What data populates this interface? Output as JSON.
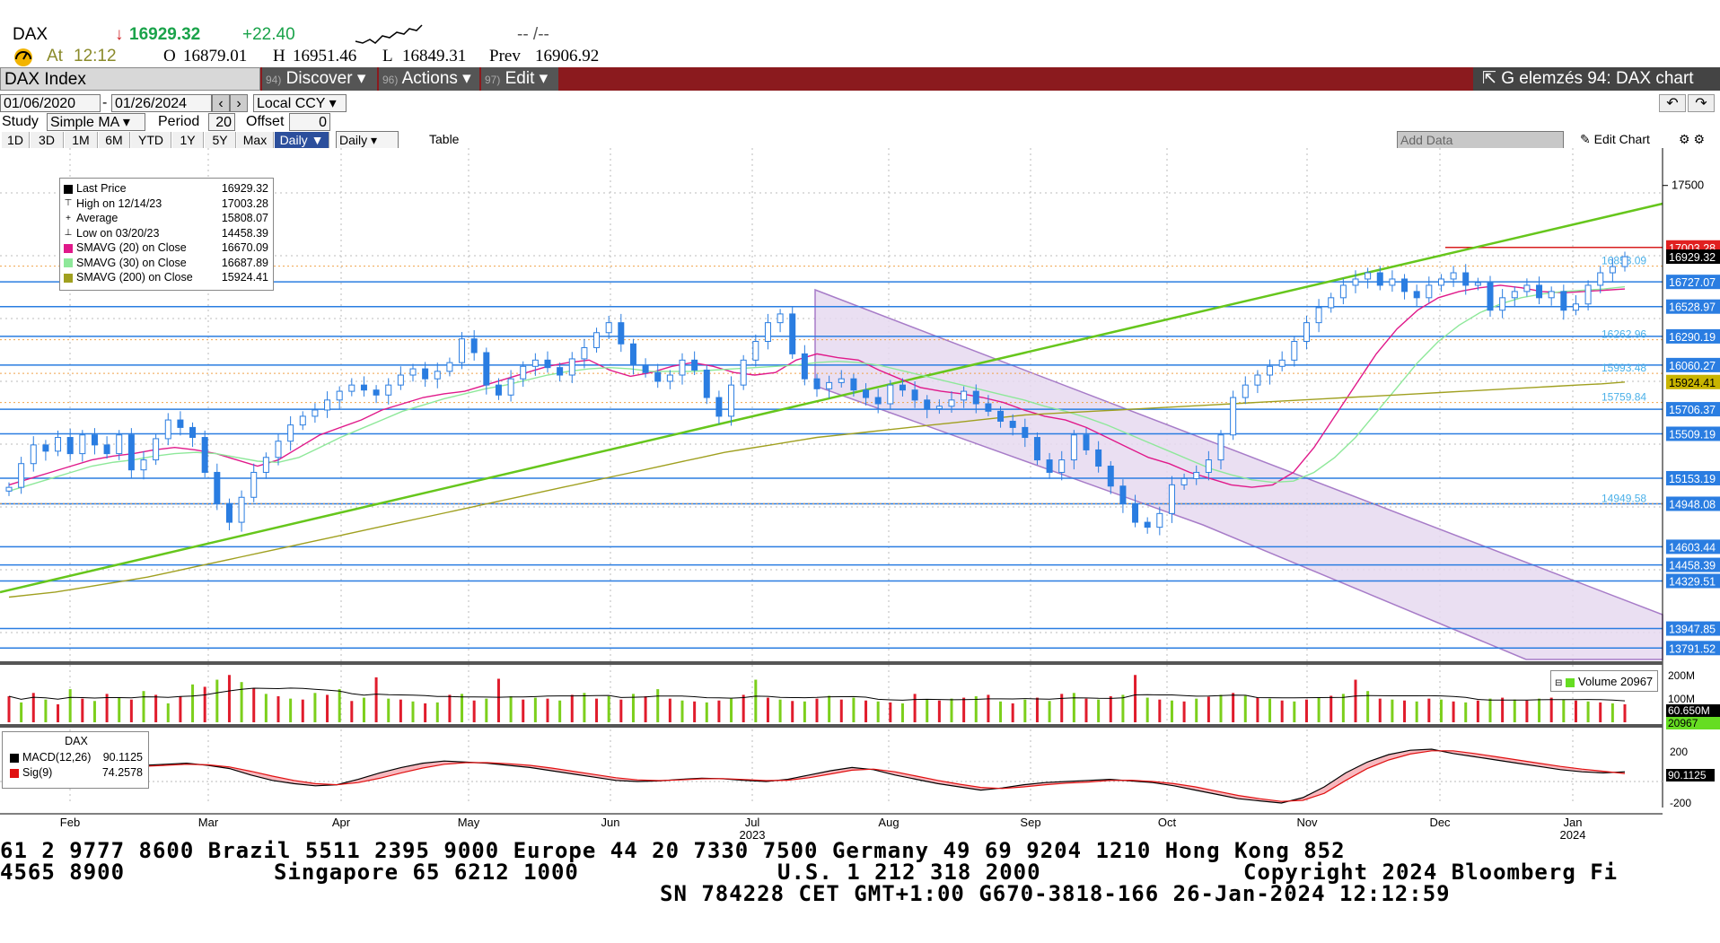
{
  "quote": {
    "ticker": "DAX",
    "arrow": "↓",
    "last": "16929.32",
    "change": "+22.40",
    "dashes": "-- /--",
    "at_label": "At",
    "time": "12:12",
    "open_label": "O",
    "open": "16879.01",
    "high_label": "H",
    "high": "16951.46",
    "low_label": "L",
    "low": "16849.31",
    "prev_label": "Prev",
    "prev": "16906.92"
  },
  "toolbar": {
    "security": "DAX Index",
    "discover_num": "94)",
    "discover": "Discover",
    "actions_num": "96)",
    "actions": "Actions",
    "edit_num": "97)",
    "edit": "Edit",
    "title": "G elemzés 94: DAX chart"
  },
  "controls": {
    "start_date": "01/06/2020",
    "end_date": "01/26/2024",
    "currency": "Local CCY",
    "study_label": "Study",
    "study_value": "Simple MA",
    "period_label": "Period",
    "period_value": "20",
    "offset_label": "Offset",
    "offset_value": "0",
    "periods": [
      "1D",
      "3D",
      "1M",
      "6M",
      "YTD",
      "1Y",
      "5Y",
      "Max"
    ],
    "frequency": "Daily",
    "table_label": "Table",
    "add_data": "Add Data",
    "edit_chart": "Edit Chart"
  },
  "legend": [
    {
      "label": "Last Price",
      "value": "16929.32",
      "swatch": "#000000",
      "mark": "■"
    },
    {
      "label": "High on 12/14/23",
      "value": "17003.28",
      "swatch": "",
      "mark": "⊤"
    },
    {
      "label": "Average",
      "value": "15808.07",
      "swatch": "",
      "mark": "+"
    },
    {
      "label": "Low on 03/20/23",
      "value": "14458.39",
      "swatch": "",
      "mark": "⊥"
    },
    {
      "label": "SMAVG (20)  on Close",
      "value": "16670.09",
      "swatch": "#e0198a",
      "mark": ""
    },
    {
      "label": "SMAVG (30)  on Close",
      "value": "16687.89",
      "swatch": "#8ee89a",
      "mark": ""
    },
    {
      "label": "SMAVG (200)  on Close",
      "value": "15924.41",
      "swatch": "#a0a020",
      "mark": ""
    }
  ],
  "volume_legend": {
    "label": "Volume",
    "value": "20967"
  },
  "macd_legend": {
    "title": "DAX",
    "rows": [
      {
        "label": "MACD(12,26)",
        "value": "90.1125",
        "swatch": "#000000"
      },
      {
        "label": "Sig(9)",
        "value": "74.2578",
        "swatch": "#e01010"
      }
    ]
  },
  "chart_data": {
    "type": "candlestick",
    "x_labels": [
      "Feb",
      "Mar",
      "Apr",
      "May",
      "Jun",
      "Jul",
      "Aug",
      "Sep",
      "Oct",
      "Nov",
      "Dec",
      "Jan"
    ],
    "year_labels": {
      "Jul": "2023",
      "Jan": "2024"
    },
    "price_axis": {
      "ticks": [
        "17500"
      ],
      "ylim": [
        13700,
        17800
      ]
    },
    "price_tags": [
      {
        "value": 17003.28,
        "label": "17003.28",
        "color": "#e02020"
      },
      {
        "value": 16929.32,
        "label": "16929.32",
        "color": "#000000"
      },
      {
        "value": 16727.07,
        "label": "16727.07",
        "color": "#2a7de1"
      },
      {
        "value": 16528.97,
        "label": "16528.97",
        "color": "#2a7de1"
      },
      {
        "value": 16290.19,
        "label": "16290.19",
        "color": "#2a7de1"
      },
      {
        "value": 16060.27,
        "label": "16060.27",
        "color": "#2a7de1"
      },
      {
        "value": 15924.41,
        "label": "15924.41",
        "color": "#c8b400"
      },
      {
        "value": 15706.37,
        "label": "15706.37",
        "color": "#2a7de1"
      },
      {
        "value": 15509.19,
        "label": "15509.19",
        "color": "#2a7de1"
      },
      {
        "value": 15153.19,
        "label": "15153.19",
        "color": "#2a7de1"
      },
      {
        "value": 14948.08,
        "label": "14948.08",
        "color": "#2a7de1"
      },
      {
        "value": 14603.44,
        "label": "14603.44",
        "color": "#2a7de1"
      },
      {
        "value": 14458.39,
        "label": "14458.39",
        "color": "#2a7de1"
      },
      {
        "value": 14329.51,
        "label": "14329.51",
        "color": "#2a7de1"
      },
      {
        "value": 13947.85,
        "label": "13947.85",
        "color": "#2a7de1"
      },
      {
        "value": 13791.52,
        "label": "13791.52",
        "color": "#2a7de1"
      }
    ],
    "fib_labels": [
      {
        "value": 16853.09,
        "label": "16853.09"
      },
      {
        "value": 16262.96,
        "label": "16262.96"
      },
      {
        "value": 15993.48,
        "label": "15993.48"
      },
      {
        "value": 15759.84,
        "label": "15759.84"
      },
      {
        "value": 14949.58,
        "label": "14949.58"
      }
    ],
    "series": [
      {
        "name": "Last Price",
        "values": [
          15080,
          15270,
          15420,
          15370,
          15480,
          15350,
          15500,
          15420,
          15350,
          15500,
          15220,
          15300,
          15470,
          15620,
          15560,
          15480,
          15200,
          14950,
          14800,
          15000,
          15200,
          15320,
          15450,
          15580,
          15650,
          15700,
          15780,
          15850,
          15900,
          15860,
          15820,
          15900,
          15980,
          16030,
          15950,
          16010,
          16080,
          16270,
          16160,
          15900,
          15820,
          15950,
          16050,
          16100,
          16040,
          15980,
          16110,
          16200,
          16320,
          16400,
          16230,
          16060,
          16000,
          15930,
          15980,
          16100,
          16020,
          15800,
          15650,
          15900,
          16100,
          16250,
          16400,
          16470,
          16150,
          15950,
          15870,
          15920,
          15950,
          15860,
          15800,
          15750,
          15900,
          15860,
          15780,
          15710,
          15730,
          15780,
          15850,
          15750,
          15690,
          15610,
          15560,
          15480,
          15300,
          15200,
          15300,
          15500,
          15380,
          15250,
          15090,
          14950,
          14800,
          14760,
          14870,
          15100,
          15150,
          15200,
          15300,
          15500,
          15800,
          15900,
          15980,
          16050,
          16100,
          16250,
          16400,
          16520,
          16600,
          16700,
          16750,
          16800,
          16700,
          16750,
          16650,
          16600,
          16700,
          16750,
          16800,
          16700,
          16720,
          16500,
          16600,
          16650,
          16700,
          16600,
          16650,
          16500,
          16550,
          16700,
          16800,
          16850,
          16929
        ]
      },
      {
        "name": "SMAVG (20)",
        "values": [
          15100,
          15150,
          15200,
          15250,
          15300,
          15330,
          15350,
          15380,
          15400,
          15380,
          15350,
          15300,
          15250,
          15300,
          15400,
          15500,
          15560,
          15620,
          15700,
          15750,
          15800,
          15830,
          15850,
          15900,
          15950,
          16000,
          16050,
          16080,
          16100,
          16020,
          15970,
          16000,
          16050,
          16080,
          16050,
          16000,
          15980,
          16000,
          16100,
          16150,
          16120,
          16100,
          16020,
          15950,
          15880,
          15850,
          15830,
          15800,
          15760,
          15700,
          15650,
          15620,
          15560,
          15480,
          15400,
          15320,
          15270,
          15200,
          15150,
          15100,
          15080,
          15100,
          15200,
          15400,
          15650,
          15900,
          16150,
          16350,
          16500,
          16600,
          16650,
          16680,
          16700,
          16680,
          16650,
          16640,
          16650,
          16660,
          16670
        ]
      },
      {
        "name": "SMAVG (30)",
        "values": [
          15050,
          15100,
          15150,
          15200,
          15250,
          15280,
          15300,
          15330,
          15350,
          15360,
          15350,
          15320,
          15290,
          15280,
          15320,
          15400,
          15480,
          15550,
          15620,
          15690,
          15740,
          15790,
          15830,
          15870,
          15900,
          15940,
          15980,
          16010,
          16030,
          16040,
          16030,
          16010,
          16010,
          16010,
          16020,
          16030,
          16040,
          16050,
          16060,
          16080,
          16090,
          16080,
          16060,
          16020,
          15980,
          15940,
          15900,
          15860,
          15820,
          15780,
          15730,
          15690,
          15640,
          15580,
          15510,
          15440,
          15370,
          15300,
          15230,
          15180,
          15140,
          15120,
          15130,
          15200,
          15320,
          15480,
          15680,
          15880,
          16080,
          16250,
          16380,
          16480,
          16550,
          16600,
          16630,
          16650,
          16660,
          16670,
          16688
        ]
      },
      {
        "name": "SMAVG (200)",
        "values": [
          14200,
          14220,
          14240,
          14270,
          14300,
          14330,
          14360,
          14400,
          14440,
          14480,
          14520,
          14560,
          14600,
          14640,
          14680,
          14720,
          14760,
          14800,
          14840,
          14880,
          14920,
          14960,
          15000,
          15040,
          15080,
          15120,
          15160,
          15200,
          15240,
          15280,
          15320,
          15360,
          15390,
          15420,
          15450,
          15480,
          15500,
          15520,
          15540,
          15560,
          15580,
          15600,
          15620,
          15640,
          15660,
          15670,
          15680,
          15690,
          15700,
          15710,
          15720,
          15730,
          15740,
          15750,
          15760,
          15770,
          15780,
          15790,
          15800,
          15810,
          15820,
          15830,
          15840,
          15850,
          15860,
          15870,
          15880,
          15890,
          15900,
          15910,
          15924
        ]
      }
    ],
    "volume_axis": {
      "ticks": [
        "200M",
        "100M"
      ],
      "tags": [
        {
          "label": "60.650M",
          "color": "#000000"
        },
        {
          "label": "20967",
          "color": "#66dd22"
        }
      ]
    },
    "volume": [
      55,
      42,
      62,
      48,
      38,
      70,
      50,
      45,
      60,
      52,
      48,
      66,
      58,
      40,
      55,
      80,
      75,
      90,
      100,
      85,
      72,
      60,
      55,
      50,
      48,
      62,
      58,
      70,
      45,
      52,
      95,
      50,
      48,
      44,
      40,
      42,
      58,
      60,
      46,
      50,
      92,
      55,
      48,
      52,
      50,
      46,
      58,
      62,
      50,
      55,
      48,
      60,
      55,
      70,
      50,
      46,
      44,
      42,
      46,
      50,
      58,
      90,
      52,
      48,
      45,
      44,
      50,
      56,
      48,
      52,
      46,
      44,
      42,
      40,
      60,
      48,
      46,
      50,
      52,
      55,
      58,
      44,
      40,
      48,
      52,
      45,
      60,
      62,
      50,
      48,
      55,
      58,
      100,
      52,
      48,
      46,
      44,
      50,
      54,
      58,
      62,
      56,
      52,
      50,
      46,
      44,
      48,
      52,
      56,
      60,
      90,
      66,
      50,
      48,
      46,
      44,
      50,
      48,
      44,
      42,
      46,
      50,
      52,
      48,
      46,
      50,
      52,
      48,
      46,
      44,
      42,
      40,
      38
    ],
    "macd_axis": {
      "ticks": [
        "200",
        "0",
        "-200"
      ],
      "tag": "90.1125"
    },
    "macd": [
      150,
      160,
      170,
      150,
      120,
      60,
      10,
      -20,
      -40,
      -30,
      20,
      80,
      130,
      170,
      190,
      180,
      170,
      150,
      130,
      100,
      70,
      40,
      10,
      0,
      5,
      20,
      30,
      25,
      10,
      0,
      20,
      60,
      100,
      130,
      110,
      60,
      20,
      -20,
      -50,
      -80,
      -60,
      -30,
      -10,
      0,
      10,
      20,
      5,
      -10,
      -40,
      -80,
      -120,
      -160,
      -180,
      -200,
      -150,
      -50,
      80,
      180,
      250,
      290,
      300,
      260,
      230,
      200,
      170,
      140,
      110,
      90,
      80,
      90
    ],
    "signal": [
      140,
      150,
      160,
      155,
      135,
      95,
      50,
      10,
      -20,
      -30,
      -10,
      30,
      80,
      125,
      160,
      175,
      175,
      165,
      150,
      125,
      95,
      65,
      35,
      15,
      8,
      15,
      25,
      27,
      18,
      8,
      12,
      35,
      70,
      105,
      115,
      90,
      50,
      10,
      -25,
      -55,
      -65,
      -50,
      -30,
      -15,
      -5,
      10,
      12,
      0,
      -20,
      -50,
      -90,
      -130,
      -160,
      -185,
      -175,
      -110,
      10,
      120,
      200,
      255,
      285,
      285,
      260,
      230,
      200,
      170,
      140,
      115,
      95,
      74
    ]
  },
  "footer": {
    "line1": "61 2 9777 8600 Brazil 5511 2395 9000 Europe 44 20 7330 7500 Germany 49 69 9204 1210 Hong Kong 852",
    "line2a": "4565 8900",
    "line2b": "Singapore 65 6212 1000",
    "line2c": "U.S. 1 212 318 2000",
    "line2d": "Copyright 2024 Bloomberg Fi",
    "line3": "SN 784228 CET  GMT+1:00 G670-3818-166 26-Jan-2024 12:12:59"
  }
}
